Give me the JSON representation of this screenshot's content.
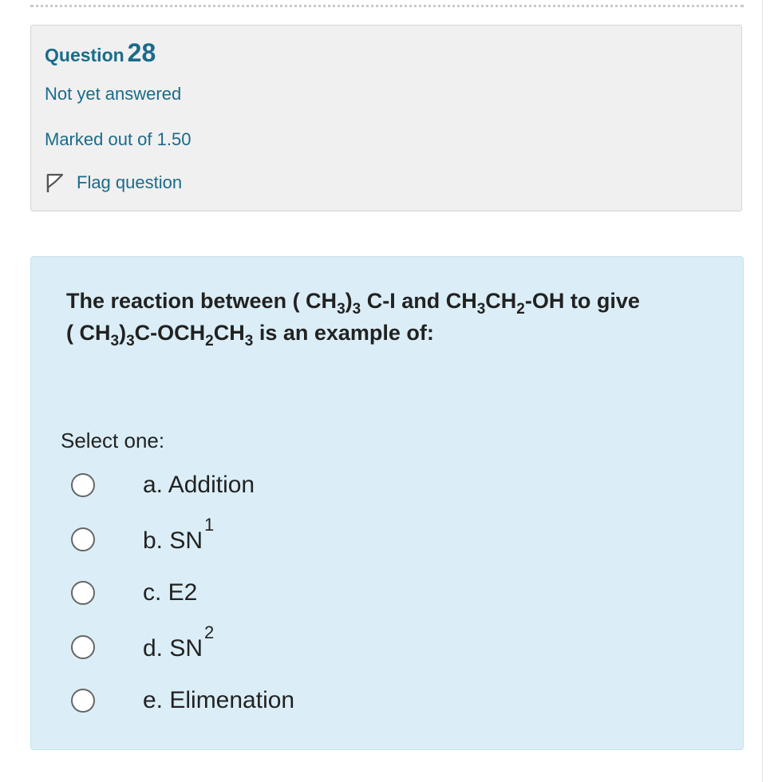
{
  "question": {
    "label": "Question",
    "number": "28",
    "state": "Not yet answered",
    "grade": "Marked out of 1.50",
    "flag_label": "Flag question"
  },
  "content": {
    "text_parts": {
      "p1": "The reaction between ( CH",
      "s1": "3",
      "p2": ")",
      "s2": "3",
      "p3": " C-I and CH",
      "s3": "3",
      "p4": "CH",
      "s4": "2",
      "p5": "-OH to give",
      "p6": "( CH",
      "s5": "3",
      "p7": ")",
      "s6": "3",
      "p8": "C-OCH",
      "s7": "2",
      "p9": "CH",
      "s8": "3",
      "p10": " is an example of:"
    },
    "prompt": "Select one:",
    "options": [
      {
        "label": "a. Addition",
        "sup": ""
      },
      {
        "label": "b. SN",
        "sup": "1"
      },
      {
        "label": "c. E2",
        "sup": ""
      },
      {
        "label": "d. SN",
        "sup": "2"
      },
      {
        "label": "e. Elimenation",
        "sup": ""
      }
    ]
  },
  "colors": {
    "info_bg": "#f0f0f0",
    "link_text": "#1a6b8a",
    "question_bg": "#dbeef7"
  }
}
